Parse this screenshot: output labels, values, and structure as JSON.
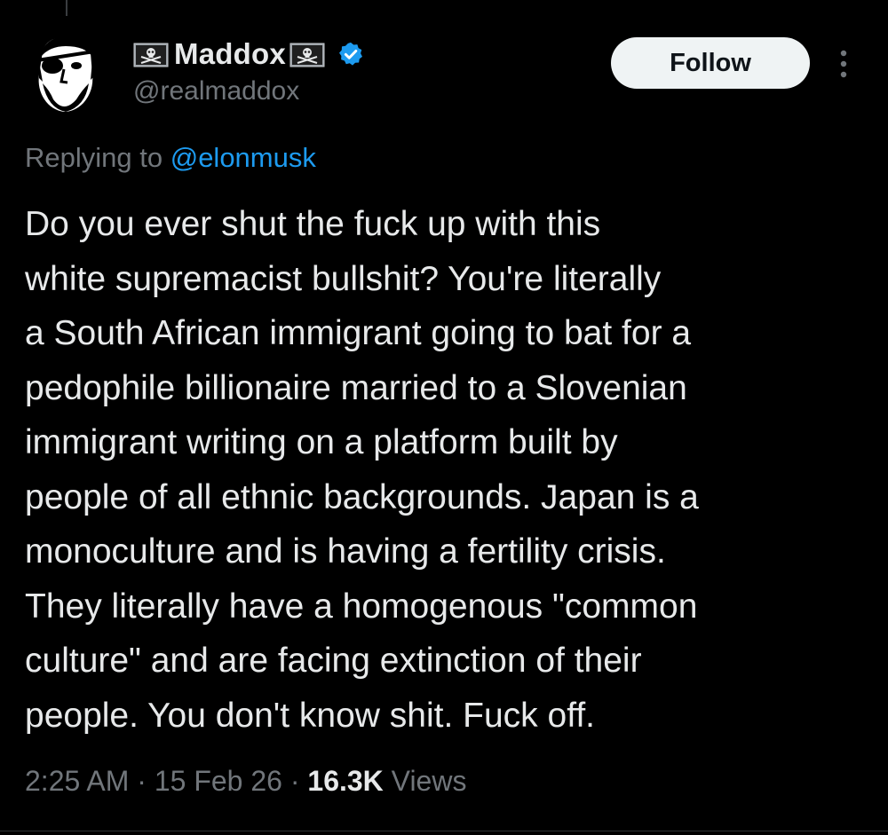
{
  "author": {
    "flag_left_icon": "pirate-flag-icon",
    "display_name": "Maddox",
    "flag_right_icon": "pirate-flag-icon",
    "verified_icon": "verified-badge-icon",
    "handle": "@realmaddox",
    "avatar_icon": "eyepatch-avatar-icon"
  },
  "actions": {
    "follow_label": "Follow",
    "more_icon": "more-vertical-icon"
  },
  "reply": {
    "prefix": "Replying to ",
    "mention": "@elonmusk"
  },
  "tweet": {
    "lines": [
      "Do you ever shut the fuck up with this",
      "white supremacist bullshit? You're literally",
      "a South African immigrant going to bat for a",
      "pedophile billionaire married to a Slovenian",
      "immigrant writing on a platform built by",
      "people of all ethnic backgrounds. Japan is a",
      "monoculture and is having a fertility crisis.",
      "They literally have a homogenous \"common",
      "culture\" and are facing extinction of their",
      "people. You don't know shit. Fuck off."
    ]
  },
  "meta": {
    "time": "2:25 AM",
    "separator": " · ",
    "date": "15 Feb 26",
    "views_count": "16.3K",
    "views_label": " Views"
  },
  "colors": {
    "background": "#000000",
    "text_primary": "#e7e9ea",
    "text_secondary": "#71767b",
    "link": "#1d9bf0",
    "follow_bg": "#eff3f4",
    "verified": "#1d9bf0"
  }
}
